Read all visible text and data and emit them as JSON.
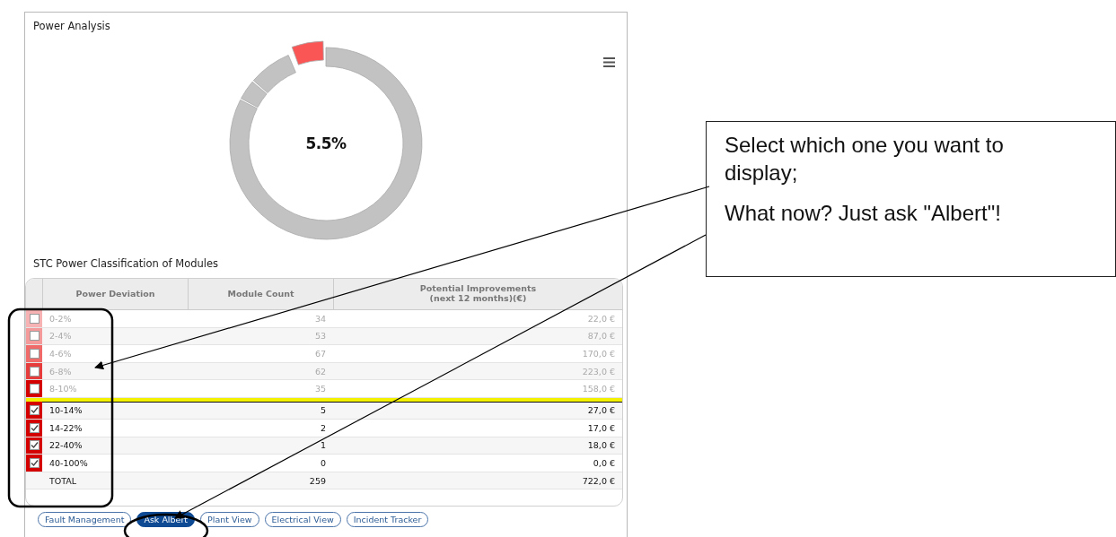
{
  "panel": {
    "title": "Power Analysis",
    "donut_label": "5.5%"
  },
  "table": {
    "title": "STC Power Classification of Modules",
    "columns": [
      "Power Deviation",
      "Module Count",
      "Potential Improvements\n(next 12 months)(€)"
    ],
    "rows": [
      {
        "kind": "class",
        "deviation": "0-2%",
        "count": "34",
        "improvement": "22,0 €",
        "checked": false,
        "color": "#f7b3b3"
      },
      {
        "kind": "class",
        "deviation": "2-4%",
        "count": "53",
        "improvement": "87,0 €",
        "checked": false,
        "color": "#f49a9a"
      },
      {
        "kind": "class",
        "deviation": "4-6%",
        "count": "67",
        "improvement": "170,0 €",
        "checked": false,
        "color": "#f06a6a"
      },
      {
        "kind": "class",
        "deviation": "6-8%",
        "count": "62",
        "improvement": "223,0 €",
        "checked": false,
        "color": "#e63c3c"
      },
      {
        "kind": "class",
        "deviation": "8-10%",
        "count": "35",
        "improvement": "158,0 €",
        "checked": false,
        "color": "#d40000"
      },
      {
        "kind": "class",
        "deviation": "10-14%",
        "count": "5",
        "improvement": "27,0 €",
        "checked": true,
        "color": "#d40000"
      },
      {
        "kind": "class",
        "deviation": "14-22%",
        "count": "2",
        "improvement": "17,0 €",
        "checked": true,
        "color": "#d40000"
      },
      {
        "kind": "class",
        "deviation": "22-40%",
        "count": "1",
        "improvement": "18,0 €",
        "checked": true,
        "color": "#d40000"
      },
      {
        "kind": "class",
        "deviation": "40-100%",
        "count": "0",
        "improvement": "0,0 €",
        "checked": true,
        "color": "#d40000"
      },
      {
        "kind": "total",
        "deviation": "TOTAL",
        "count": "259",
        "improvement": "722,0 €"
      }
    ]
  },
  "buttons": [
    {
      "label": "Fault Management",
      "selected": false
    },
    {
      "label": "Ask Albert",
      "selected": true
    },
    {
      "label": "Plant View",
      "selected": false
    },
    {
      "label": "Electrical View",
      "selected": false
    },
    {
      "label": "Incident Tracker",
      "selected": false
    }
  ],
  "callout": {
    "paragraphs": [
      "Select which one you want to display;",
      "What now? Just ask \"Albert\"!"
    ]
  }
}
